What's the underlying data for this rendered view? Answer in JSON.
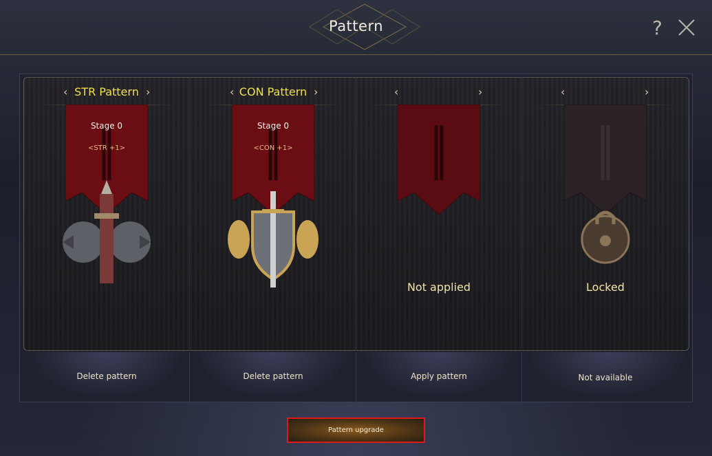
{
  "window": {
    "title": "Pattern",
    "help_label": "?",
    "icons": {
      "help": "question-mark-icon",
      "close": "close-x-icon"
    }
  },
  "patterns": [
    {
      "name": "STR Pattern",
      "stage": "Stage 0",
      "stat": "<STR +1>",
      "status": "",
      "emblem": "spiked-sword-emblem",
      "action": "Delete pattern"
    },
    {
      "name": "CON Pattern",
      "stage": "Stage 0",
      "stat": "<CON +1>",
      "status": "",
      "emblem": "lion-shield-emblem",
      "action": "Delete pattern"
    },
    {
      "name": "",
      "stage": "",
      "stat": "",
      "status": "Not applied",
      "emblem": "",
      "action": "Apply pattern"
    },
    {
      "name": "",
      "stage": "",
      "stat": "",
      "status": "Locked",
      "emblem": "padlock-icon",
      "action": "Not available"
    }
  ],
  "arrows": {
    "left": "‹",
    "right": "›"
  },
  "upgrade_button": {
    "label": "Pattern upgrade"
  },
  "colors": {
    "title_yellow": "#f0e04a",
    "banner_red": "#6a0e14",
    "highlight_border": "#e01818"
  }
}
